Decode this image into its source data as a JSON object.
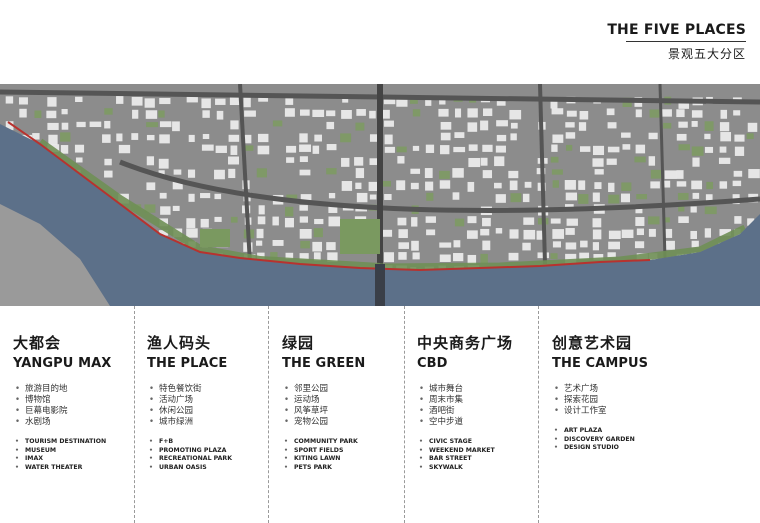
{
  "header": {
    "title_en": "THE FIVE PLACES",
    "title_zh": "景观五大分区"
  },
  "zones": [
    {
      "key": "yangpu-max",
      "zh_title": "大都会",
      "en_title": "YANGPU MAX",
      "zh_items": [
        "旅游目的地",
        "博物馆",
        "巨幕电影院",
        "水剧场"
      ],
      "en_items": [
        "TOURISM DESTINATION",
        "MUSEUM",
        "IMAX",
        "WATER THEATER"
      ]
    },
    {
      "key": "the-place",
      "zh_title": "渔人码头",
      "en_title": "THE PLACE",
      "zh_items": [
        "特色餐饮街",
        "活动广场",
        "休闲公园",
        "城市绿洲"
      ],
      "en_items": [
        "F+B",
        "PROMOTING PLAZA",
        "RECREATIONAL PARK",
        "URBAN OASIS"
      ]
    },
    {
      "key": "the-green",
      "zh_title": "绿园",
      "en_title": "THE GREEN",
      "zh_items": [
        "邻里公园",
        "运动场",
        "风筝草坪",
        "宠物公园"
      ],
      "en_items": [
        "COMMUNITY PARK",
        "SPORT FIELDS",
        "KITING LAWN",
        "PETS PARK"
      ]
    },
    {
      "key": "cbd",
      "zh_title": "中央商务广场",
      "en_title": "CBD",
      "zh_items": [
        "城市舞台",
        "周末市集",
        "酒吧街",
        "空中步道"
      ],
      "en_items": [
        "CIVIC STAGE",
        "WEEKEND MARKET",
        "BAR STREET",
        "SKYWALK"
      ]
    },
    {
      "key": "the-campus",
      "zh_title": "创意艺术园",
      "en_title": "THE CAMPUS",
      "zh_items": [
        "艺术广场",
        "探索花园",
        "设计工作室"
      ],
      "en_items": [
        "ART PLAZA",
        "DISCOVERY GARDEN",
        "DESIGN STUDIO"
      ]
    }
  ],
  "colors": {
    "river": "#5a6f88",
    "city": "#8a8a8a",
    "building": "#f2f2f2",
    "park": "#6f8f55",
    "waterfront_edge": "#b8322e",
    "road": "#5c5c5c"
  }
}
